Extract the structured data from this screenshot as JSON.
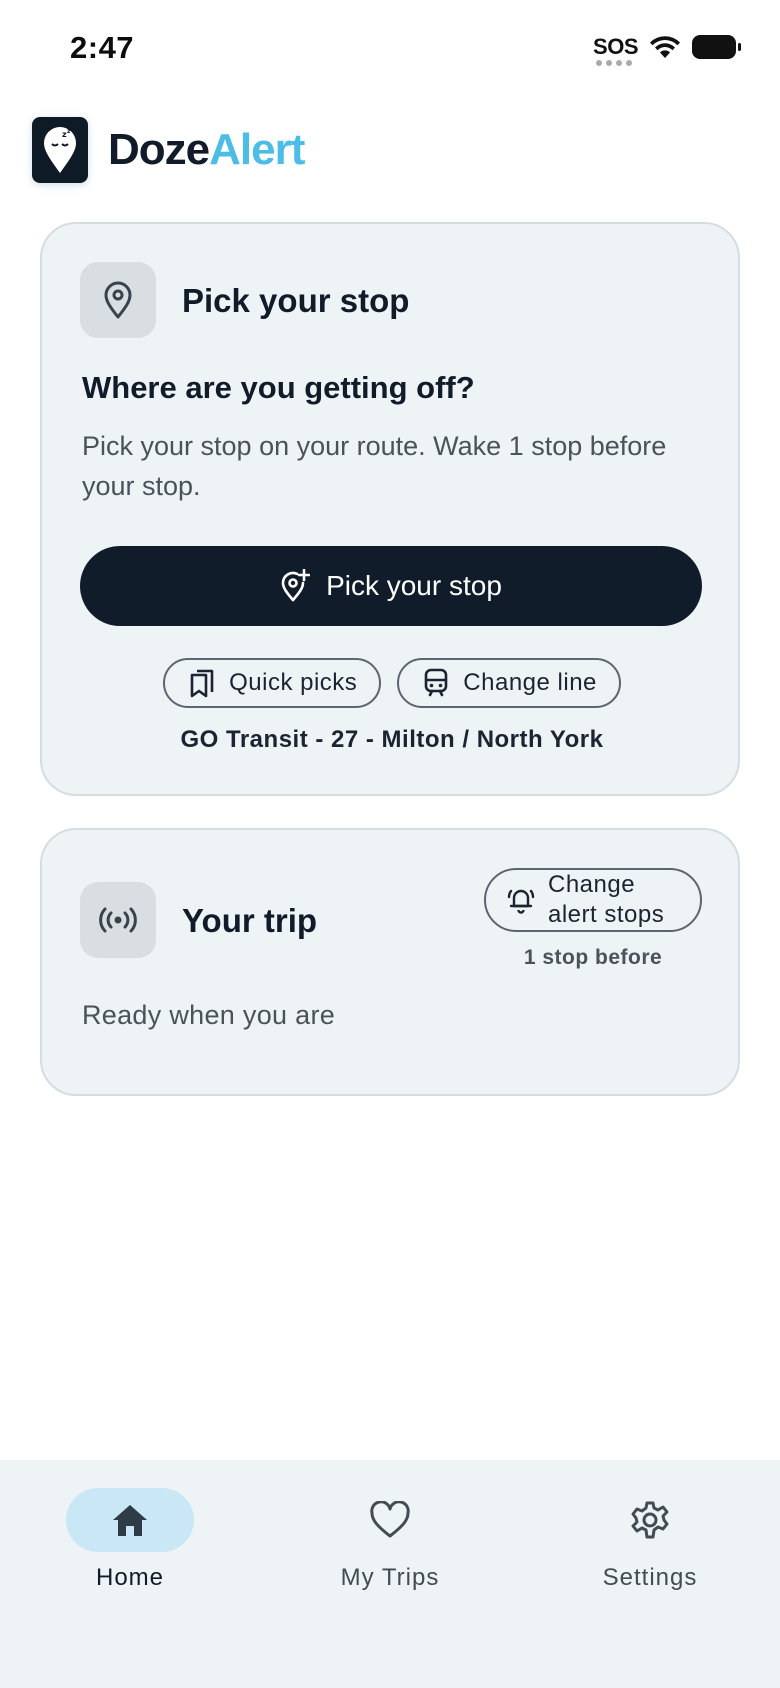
{
  "status_bar": {
    "time": "2:47",
    "sos": "SOS"
  },
  "header": {
    "title_part1": "Doze",
    "title_part2": "Alert",
    "logo_icon": "sleepy-pin-logo"
  },
  "pick_card": {
    "title": "Pick your stop",
    "question": "Where are you getting off?",
    "description": "Pick your stop on your route. Wake 1 stop before your stop.",
    "primary_button": "Pick your stop",
    "quick_picks": "Quick picks",
    "change_line": "Change line",
    "route": "GO Transit - 27 - Milton / North York"
  },
  "trip_card": {
    "title": "Your trip",
    "alert_button_line1": "Change",
    "alert_button_line2": "alert stops",
    "alert_sub": "1 stop before",
    "status": "Ready when you are"
  },
  "nav": {
    "items": [
      {
        "label": "Home",
        "icon": "home-icon",
        "active": true
      },
      {
        "label": "My Trips",
        "icon": "heart-icon",
        "active": false
      },
      {
        "label": "Settings",
        "icon": "gear-icon",
        "active": false
      }
    ]
  },
  "colors": {
    "brand_dark": "#111c2b",
    "brand_accent": "#4cbde7",
    "card_bg": "#eef3f6",
    "nav_active": "#c9e7f5"
  }
}
